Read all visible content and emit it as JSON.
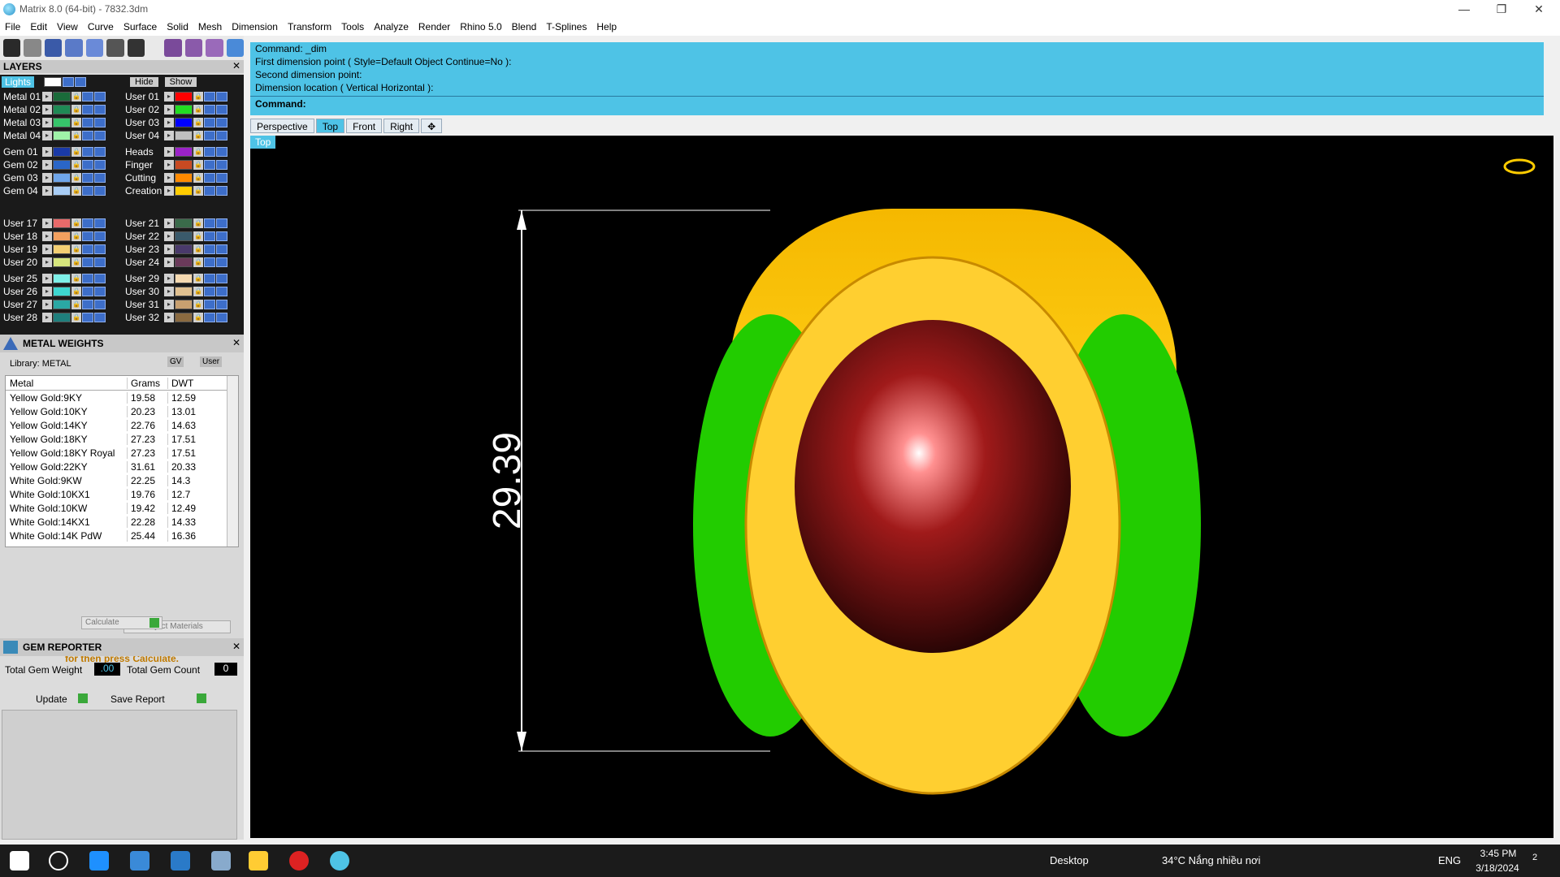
{
  "window": {
    "title": "Matrix 8.0 (64-bit) - 7832.3dm",
    "minimize": "—",
    "maximize": "❐",
    "close": "✕"
  },
  "menu": [
    "File",
    "Edit",
    "View",
    "Curve",
    "Surface",
    "Solid",
    "Mesh",
    "Dimension",
    "Transform",
    "Tools",
    "Analyze",
    "Render",
    "Rhino 5.0",
    "Blend",
    "T-Splines",
    "Help"
  ],
  "layers": {
    "title": "LAYERS",
    "lights_label": "Lights",
    "hide_label": "Hide",
    "show_label": "Show",
    "left_col": [
      {
        "name": "Metal 01",
        "color": "#1a6b3a"
      },
      {
        "name": "Metal 02",
        "color": "#1f8a55"
      },
      {
        "name": "Metal 03",
        "color": "#36c46a"
      },
      {
        "name": "Metal 04",
        "color": "#9ff2a8"
      },
      {
        "name": "Gem 01",
        "color": "#1a3aa8"
      },
      {
        "name": "Gem 02",
        "color": "#2a66c8"
      },
      {
        "name": "Gem 03",
        "color": "#6fa6ea"
      },
      {
        "name": "Gem 04",
        "color": "#a8cdf5"
      },
      {
        "name": "User 17",
        "color": "#e86a6a"
      },
      {
        "name": "User 18",
        "color": "#f2a05f"
      },
      {
        "name": "User 19",
        "color": "#f3cf73"
      },
      {
        "name": "User 20",
        "color": "#d6e67d"
      },
      {
        "name": "User 25",
        "color": "#7ef0e8"
      },
      {
        "name": "User 26",
        "color": "#3ed6d0"
      },
      {
        "name": "User 27",
        "color": "#2aa8a4"
      },
      {
        "name": "User 28",
        "color": "#1f7f7d"
      }
    ],
    "right_col": [
      {
        "name": "User 01",
        "color": "#ff0000"
      },
      {
        "name": "User 02",
        "color": "#22dd22"
      },
      {
        "name": "User 03",
        "color": "#0000ff"
      },
      {
        "name": "User 04",
        "color": "#bfbfbf"
      },
      {
        "name": "Heads",
        "color": "#9b22c8"
      },
      {
        "name": "Finger",
        "color": "#c84a22"
      },
      {
        "name": "Cutting",
        "color": "#ff8a00"
      },
      {
        "name": "Creation",
        "color": "#ffcc00"
      },
      {
        "name": "User 21",
        "color": "#3a6b4a"
      },
      {
        "name": "User 22",
        "color": "#3a5a6b"
      },
      {
        "name": "User 23",
        "color": "#4a3a6b"
      },
      {
        "name": "User 24",
        "color": "#6b3a5a"
      },
      {
        "name": "User 29",
        "color": "#f5d9b0"
      },
      {
        "name": "User 30",
        "color": "#e0c090"
      },
      {
        "name": "User 31",
        "color": "#c8a070"
      },
      {
        "name": "User 32",
        "color": "#8a6a40"
      }
    ]
  },
  "metal_weights": {
    "title": "METAL WEIGHTS",
    "library": "Library: METAL",
    "gv_label": "GV",
    "user_label": "User",
    "columns": [
      "Metal",
      "Grams",
      "DWT"
    ],
    "rows": [
      [
        "Yellow Gold:9KY",
        "19.58",
        "12.59"
      ],
      [
        "Yellow Gold:10KY",
        "20.23",
        "13.01"
      ],
      [
        "Yellow Gold:14KY",
        "22.76",
        "14.63"
      ],
      [
        "Yellow Gold:18KY",
        "27.23",
        "17.51"
      ],
      [
        "Yellow Gold:18KY Royal",
        "27.23",
        "17.51"
      ],
      [
        "Yellow Gold:22KY",
        "31.61",
        "20.33"
      ],
      [
        "White Gold:9KW",
        "22.25",
        "14.3"
      ],
      [
        "White Gold:10KX1",
        "19.76",
        "12.7"
      ],
      [
        "White Gold:10KW",
        "19.42",
        "12.49"
      ],
      [
        "White Gold:14KX1",
        "22.28",
        "14.33"
      ],
      [
        "White Gold:14K PdW",
        "25.44",
        "16.36"
      ]
    ],
    "use_object_materials": "Use Object Materials",
    "hint": "Highlight the item you want to find the weight for then press Calculate.",
    "calculate": "Calculate"
  },
  "gem_reporter": {
    "title": "GEM REPORTER",
    "total_weight_label": "Total Gem Weight",
    "total_weight_value": ".00",
    "total_count_label": "Total Gem Count",
    "total_count_value": "0",
    "update": "Update",
    "save_report": "Save Report"
  },
  "command": {
    "lines": [
      "Command: _dim",
      "First dimension point ( Style=Default  Object  Continue=No ):",
      "Second dimension point:",
      "Dimension location ( Vertical  Horizontal ):"
    ],
    "prompt": "Command:"
  },
  "viewport_tabs": [
    "Perspective",
    "Top",
    "Front",
    "Right"
  ],
  "viewport": {
    "label": "Top",
    "dimension": "29.39"
  },
  "taskbar": {
    "desktop": "Desktop",
    "weather": "34°C  Nắng nhiều nơi",
    "lang": "ENG",
    "time": "3:45 PM",
    "date": "3/18/2024",
    "notif": "2"
  }
}
